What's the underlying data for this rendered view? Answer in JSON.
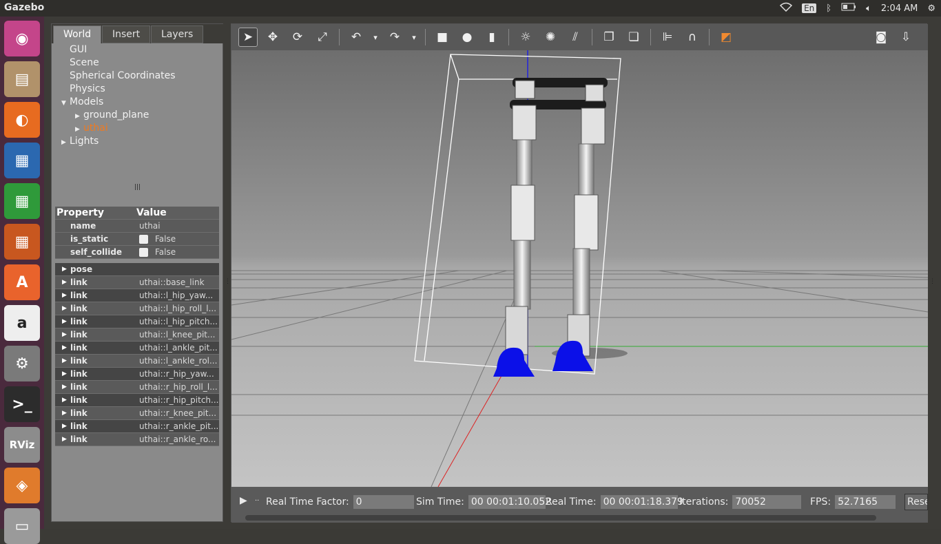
{
  "topbar": {
    "app_title": "Gazebo",
    "keyboard": "En",
    "clock": "2:04 AM",
    "icons": [
      "wifi-icon",
      "keyboard-icon",
      "bluetooth-icon",
      "battery-icon",
      "volume-icon",
      "settings-icon"
    ]
  },
  "launcher": [
    {
      "name": "ubuntu-dash",
      "glyph": "◉",
      "color": "#c4458a"
    },
    {
      "name": "files",
      "glyph": "▤",
      "color": "#b1926a"
    },
    {
      "name": "firefox",
      "glyph": "◐",
      "color": "#e76b20"
    },
    {
      "name": "writer",
      "glyph": "▦",
      "color": "#2b68b0"
    },
    {
      "name": "calc",
      "glyph": "▦",
      "color": "#2f9a3a"
    },
    {
      "name": "impress",
      "glyph": "▦",
      "color": "#c8571f"
    },
    {
      "name": "software",
      "glyph": "A",
      "color": "#e9632c"
    },
    {
      "name": "amazon",
      "glyph": "a",
      "color": "#eeeeee"
    },
    {
      "name": "system-settings",
      "glyph": "⚙",
      "color": "#7a7a7a"
    },
    {
      "name": "terminal",
      "glyph": ">_",
      "color": "#2c2c2c"
    },
    {
      "name": "rviz",
      "glyph": "RViz",
      "color": "#8c8c8c"
    },
    {
      "name": "gazebo",
      "glyph": "◈",
      "color": "#e07b2c"
    },
    {
      "name": "trash",
      "glyph": "▭",
      "color": "#9a9a9a"
    }
  ],
  "tabs": [
    "World",
    "Insert",
    "Layers"
  ],
  "tree": [
    {
      "label": "GUI",
      "indent": 0,
      "caret": ""
    },
    {
      "label": "Scene",
      "indent": 0,
      "caret": ""
    },
    {
      "label": "Spherical Coordinates",
      "indent": 0,
      "caret": ""
    },
    {
      "label": "Physics",
      "indent": 0,
      "caret": ""
    },
    {
      "label": "Models",
      "indent": 0,
      "caret": "▼"
    },
    {
      "label": "ground_plane",
      "indent": 1,
      "caret": "▶"
    },
    {
      "label": "uthai",
      "indent": 1,
      "caret": "▶",
      "selected": true
    },
    {
      "label": "Lights",
      "indent": 0,
      "caret": "▶"
    }
  ],
  "handle_glyph": "|||",
  "properties": {
    "header_property": "Property",
    "header_value": "Value",
    "rows": [
      {
        "key": "name",
        "value": "uthai",
        "checkbox": false
      },
      {
        "key": "is_static",
        "value": "False",
        "checkbox": true
      },
      {
        "key": "self_collide",
        "value": "False",
        "checkbox": true
      },
      {
        "key": "pose",
        "value": "",
        "expand": true
      },
      {
        "key": "link",
        "value": "uthai::base_link",
        "expand": true
      },
      {
        "key": "link",
        "value": "uthai::l_hip_yaw...",
        "expand": true
      },
      {
        "key": "link",
        "value": "uthai::l_hip_roll_l...",
        "expand": true
      },
      {
        "key": "link",
        "value": "uthai::l_hip_pitch...",
        "expand": true
      },
      {
        "key": "link",
        "value": "uthai::l_knee_pit...",
        "expand": true
      },
      {
        "key": "link",
        "value": "uthai::l_ankle_pit...",
        "expand": true
      },
      {
        "key": "link",
        "value": "uthai::l_ankle_rol...",
        "expand": true
      },
      {
        "key": "link",
        "value": "uthai::r_hip_yaw...",
        "expand": true
      },
      {
        "key": "link",
        "value": "uthai::r_hip_roll_l...",
        "expand": true
      },
      {
        "key": "link",
        "value": "uthai::r_hip_pitch...",
        "expand": true
      },
      {
        "key": "link",
        "value": "uthai::r_knee_pit...",
        "expand": true
      },
      {
        "key": "link",
        "value": "uthai::r_ankle_pit...",
        "expand": true
      },
      {
        "key": "link",
        "value": "uthai::r_ankle_ro...",
        "expand": true
      }
    ]
  },
  "toolbar": [
    {
      "name": "select-mode-icon",
      "glyph": "➤",
      "on": true
    },
    {
      "name": "translate-mode-icon",
      "glyph": "✥"
    },
    {
      "name": "rotate-mode-icon",
      "glyph": "⟳"
    },
    {
      "name": "scale-mode-icon",
      "glyph": "⤢"
    },
    {
      "sep": true
    },
    {
      "name": "undo-icon",
      "glyph": "↶"
    },
    {
      "name": "undo-dropdown-icon",
      "glyph": "▾"
    },
    {
      "name": "redo-icon",
      "glyph": "↷"
    },
    {
      "name": "redo-dropdown-icon",
      "glyph": "▾"
    },
    {
      "sep": true
    },
    {
      "name": "box-shape-icon",
      "glyph": "■"
    },
    {
      "name": "sphere-shape-icon",
      "glyph": "●"
    },
    {
      "name": "cylinder-shape-icon",
      "glyph": "▮"
    },
    {
      "sep": true
    },
    {
      "name": "point-light-icon",
      "glyph": "☼"
    },
    {
      "name": "spot-light-icon",
      "glyph": "✺"
    },
    {
      "name": "directional-light-icon",
      "glyph": "⫽"
    },
    {
      "sep": true
    },
    {
      "name": "copy-icon",
      "glyph": "❐"
    },
    {
      "name": "paste-icon",
      "glyph": "❏"
    },
    {
      "sep": true
    },
    {
      "name": "align-icon",
      "glyph": "⊫"
    },
    {
      "name": "snap-icon",
      "glyph": "∩"
    },
    {
      "sep": true
    },
    {
      "name": "view-angle-icon",
      "glyph": "◩"
    }
  ],
  "toolbar_right": [
    {
      "name": "screenshot-icon",
      "glyph": "◙"
    },
    {
      "name": "log-icon",
      "glyph": "⇩"
    }
  ],
  "status": {
    "play_glyph": "▶",
    "dot": "..",
    "rtf_label": "Real Time Factor:",
    "rtf_value": "0",
    "sim_label": "Sim Time:",
    "sim_value": "00 00:01:10.052",
    "real_label": "Real Time:",
    "real_value": "00 00:01:18.379",
    "iter_label": "Iterations:",
    "iter_value": "70052",
    "fps_label": "FPS:",
    "fps_value": "52.7165",
    "reset_label": "Reset"
  }
}
